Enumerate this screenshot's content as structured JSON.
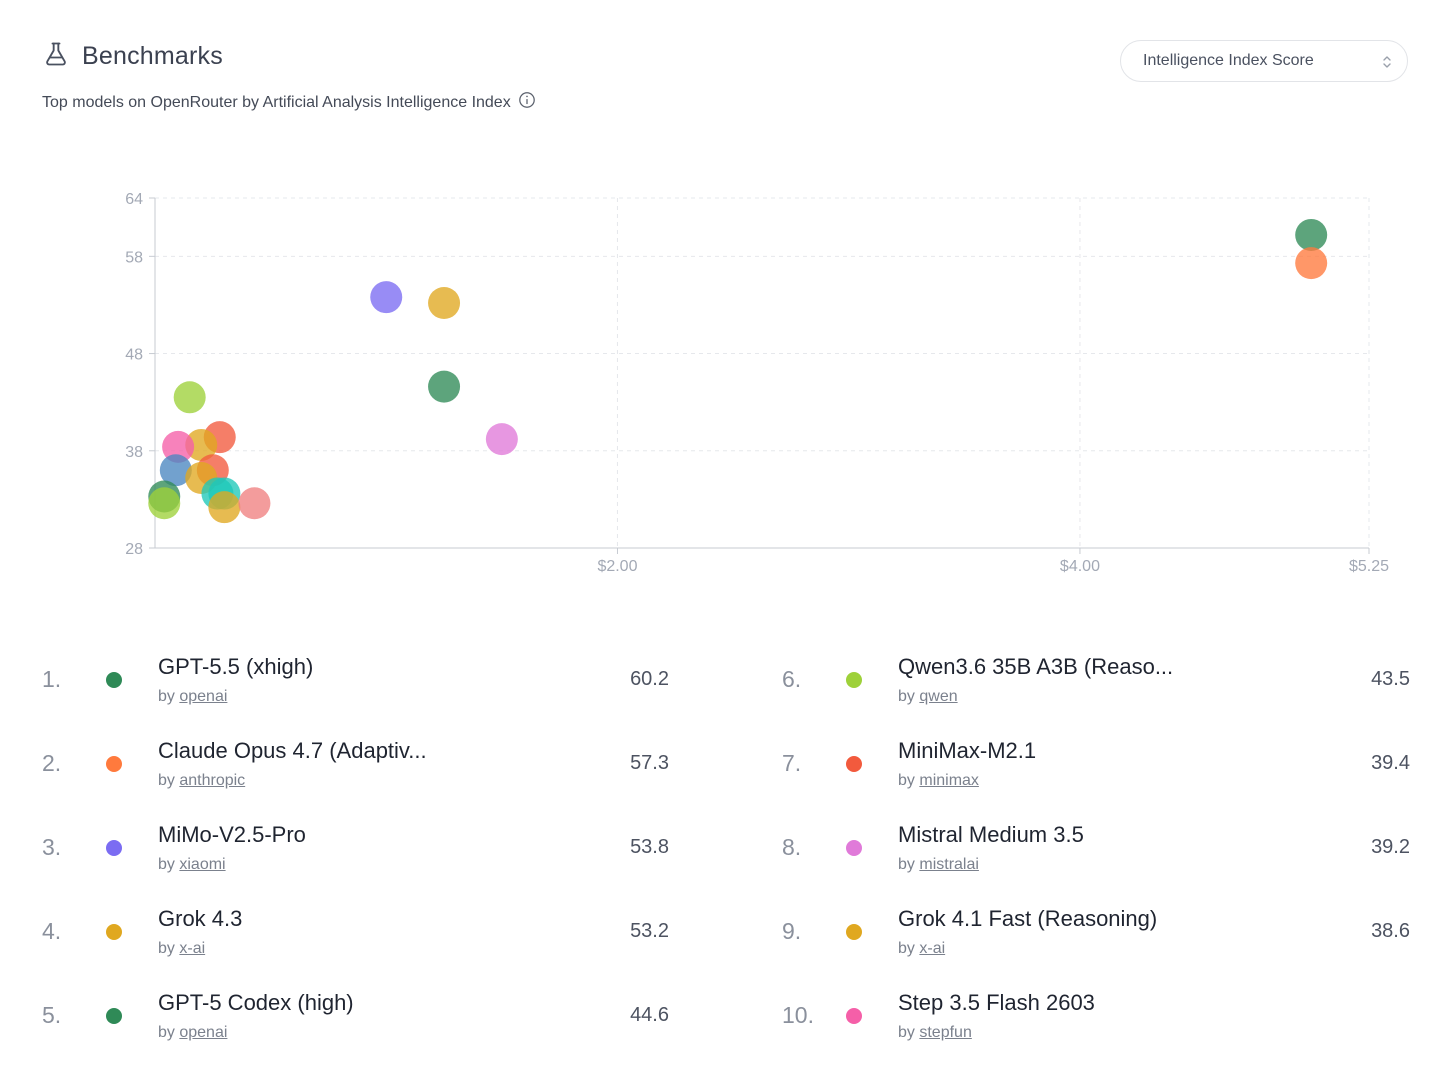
{
  "header": {
    "title": "Benchmarks",
    "subtitle": "Top models on OpenRouter by Artificial Analysis Intelligence Index",
    "icon": "flask-icon",
    "info_icon": "info-icon"
  },
  "metric_select": {
    "value": "Intelligence Index Score"
  },
  "chart_data": {
    "type": "scatter",
    "ylim": [
      28,
      64
    ],
    "xlim": [
      0,
      5.25
    ],
    "y_ticks": [
      "64",
      "58",
      "48",
      "38",
      "28"
    ],
    "y_tick_values": [
      64,
      58,
      48,
      38,
      28
    ],
    "x_ticks": [
      "$2.00",
      "$4.00",
      "$5.25"
    ],
    "x_tick_values": [
      2.0,
      4.0,
      5.25
    ],
    "grid": true,
    "points": [
      {
        "x": 5.0,
        "y": 60.2,
        "color": "#2f8a57"
      },
      {
        "x": 5.0,
        "y": 57.3,
        "color": "#ff7a3d"
      },
      {
        "x": 1.0,
        "y": 53.8,
        "color": "#7b6cf2"
      },
      {
        "x": 1.25,
        "y": 53.2,
        "color": "#e0a820"
      },
      {
        "x": 1.25,
        "y": 44.6,
        "color": "#2f8a57"
      },
      {
        "x": 0.15,
        "y": 43.5,
        "color": "#9ed13a"
      },
      {
        "x": 0.28,
        "y": 39.4,
        "color": "#f25a3d"
      },
      {
        "x": 1.5,
        "y": 39.2,
        "color": "#e07ad9"
      },
      {
        "x": 0.2,
        "y": 38.6,
        "color": "#e0a820"
      },
      {
        "x": 0.1,
        "y": 38.4,
        "color": "#f55fa8"
      },
      {
        "x": 0.09,
        "y": 36.0,
        "color": "#4a86c0"
      },
      {
        "x": 0.25,
        "y": 36.0,
        "color": "#f25a3d"
      },
      {
        "x": 0.2,
        "y": 35.2,
        "color": "#e0a820"
      },
      {
        "x": 0.27,
        "y": 33.6,
        "color": "#1ec8b8"
      },
      {
        "x": 0.3,
        "y": 33.6,
        "color": "#1ec8b8"
      },
      {
        "x": 0.04,
        "y": 33.3,
        "color": "#2f8a57"
      },
      {
        "x": 0.04,
        "y": 32.6,
        "color": "#9ed13a"
      },
      {
        "x": 0.3,
        "y": 32.2,
        "color": "#e0a820"
      },
      {
        "x": 0.43,
        "y": 32.6,
        "color": "#f08080"
      }
    ]
  },
  "leaderboard": {
    "left": [
      {
        "rank": "1.",
        "name": "GPT-5.5 (xhigh)",
        "by": "by",
        "author": "openai",
        "score": "60.2",
        "color": "#2f8a57"
      },
      {
        "rank": "2.",
        "name": "Claude Opus 4.7 (Adaptiv...",
        "by": "by",
        "author": "anthropic",
        "score": "57.3",
        "color": "#ff7a3d"
      },
      {
        "rank": "3.",
        "name": "MiMo-V2.5-Pro",
        "by": "by",
        "author": "xiaomi",
        "score": "53.8",
        "color": "#7b6cf2"
      },
      {
        "rank": "4.",
        "name": "Grok 4.3",
        "by": "by",
        "author": "x-ai",
        "score": "53.2",
        "color": "#e0a820"
      },
      {
        "rank": "5.",
        "name": "GPT-5 Codex (high)",
        "by": "by",
        "author": "openai",
        "score": "44.6",
        "color": "#2f8a57"
      }
    ],
    "right": [
      {
        "rank": "6.",
        "name": "Qwen3.6 35B A3B (Reaso...",
        "by": "by",
        "author": "qwen",
        "score": "43.5",
        "color": "#9ed13a"
      },
      {
        "rank": "7.",
        "name": "MiniMax-M2.1",
        "by": "by",
        "author": "minimax",
        "score": "39.4",
        "color": "#f25a3d"
      },
      {
        "rank": "8.",
        "name": "Mistral Medium 3.5",
        "by": "by",
        "author": "mistralai",
        "score": "39.2",
        "color": "#e07ad9"
      },
      {
        "rank": "9.",
        "name": "Grok 4.1 Fast (Reasoning)",
        "by": "by",
        "author": "x-ai",
        "score": "38.6",
        "color": "#e0a820"
      },
      {
        "rank": "10.",
        "name": "Step 3.5 Flash 2603",
        "by": "by",
        "author": "stepfun",
        "score": "",
        "color": "#f55fa8"
      }
    ]
  }
}
